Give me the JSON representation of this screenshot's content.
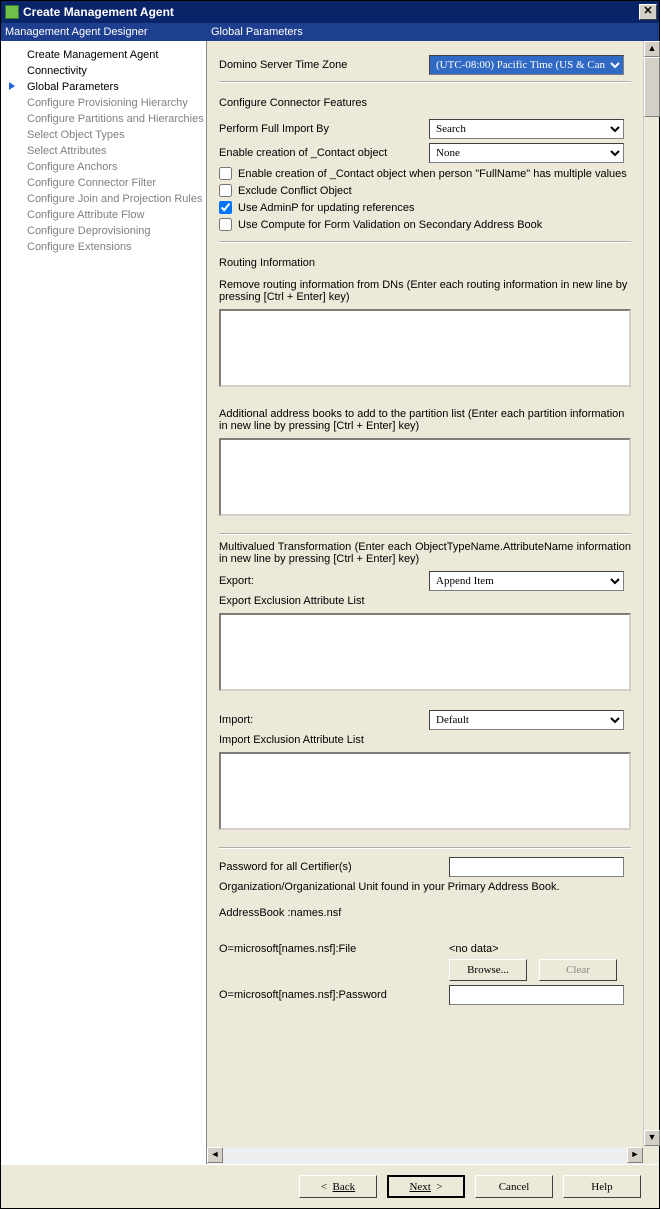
{
  "title": "Create Management Agent",
  "headers": {
    "left": "Management Agent Designer",
    "right": "Global Parameters"
  },
  "sidebar": {
    "items": [
      {
        "label": "Create Management Agent",
        "state": "enabled"
      },
      {
        "label": "Connectivity",
        "state": "enabled"
      },
      {
        "label": "Global Parameters",
        "state": "current"
      },
      {
        "label": "Configure Provisioning Hierarchy",
        "state": "disabled"
      },
      {
        "label": "Configure Partitions and Hierarchies",
        "state": "disabled"
      },
      {
        "label": "Select Object Types",
        "state": "disabled"
      },
      {
        "label": "Select Attributes",
        "state": "disabled"
      },
      {
        "label": "Configure Anchors",
        "state": "disabled"
      },
      {
        "label": "Configure Connector Filter",
        "state": "disabled"
      },
      {
        "label": "Configure Join and Projection Rules",
        "state": "disabled"
      },
      {
        "label": "Configure Attribute Flow",
        "state": "disabled"
      },
      {
        "label": "Configure Deprovisioning",
        "state": "disabled"
      },
      {
        "label": "Configure Extensions",
        "state": "disabled"
      }
    ]
  },
  "form": {
    "tz_label": "Domino Server Time Zone",
    "tz_value": "(UTC-08:00) Pacific Time (US & Can",
    "conn_features": "Configure Connector Features",
    "full_import_label": "Perform Full Import By",
    "full_import_value": "Search",
    "enable_contact_label": "Enable creation of _Contact object",
    "enable_contact_value": "None",
    "chk_multi": "Enable creation of _Contact object when person \"FullName\" has multiple values",
    "chk_exclude": "Exclude Conflict Object",
    "chk_adminp": "Use AdminP for updating references",
    "chk_compute": "Use Compute for Form Validation on Secondary Address Book",
    "routing_section": "Routing Information",
    "routing_desc": "Remove routing information from DNs (Enter each routing information in new line by pressing [Ctrl + Enter] key)",
    "addbook_desc": "Additional address books to add to the partition list (Enter each partition information in new line by pressing [Ctrl + Enter] key)",
    "multi_desc": "Multivalued Transformation (Enter each ObjectTypeName.AttributeName information in new line by pressing [Ctrl + Enter] key)",
    "export_label": "Export:",
    "export_value": "Append Item",
    "export_excl_label": "Export Exclusion Attribute List",
    "import_label": "Import:",
    "import_value": "Default",
    "import_excl_label": "Import Exclusion Attribute List",
    "cert_pwd_label": "Password for all Certifier(s)",
    "org_desc": "Organization/Organizational Unit found in your Primary Address Book.",
    "addrbook_line": "AddressBook :names.nsf",
    "file_label": "O=microsoft[names.nsf]:File",
    "file_value": "<no data>",
    "browse": "Browse...",
    "clear": "Clear",
    "pwd_label": "O=microsoft[names.nsf]:Password"
  },
  "footer": {
    "back": "Back",
    "next": "Next",
    "cancel": "Cancel",
    "help": "Help"
  }
}
